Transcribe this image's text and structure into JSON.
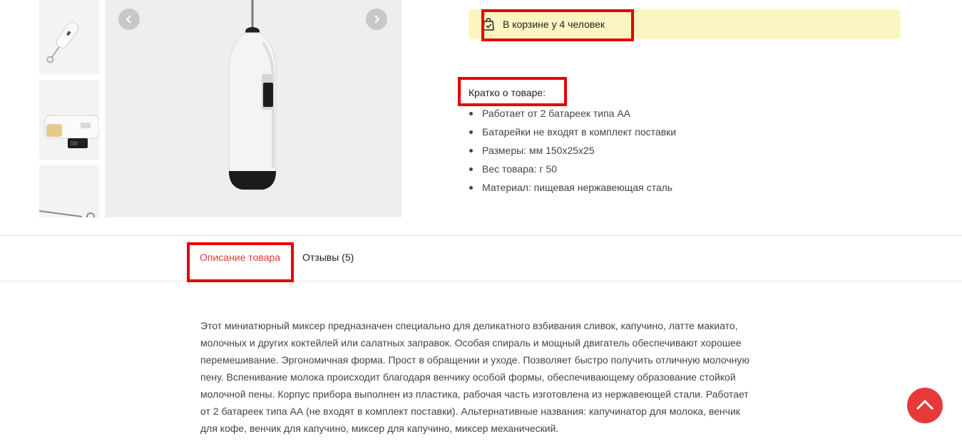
{
  "gallery": {
    "thumbnails": [
      "mixer-thumb-1",
      "mixer-thumb-2",
      "mixer-thumb-3"
    ],
    "prev_icon": "chevron-left-icon",
    "next_icon": "chevron-right-icon"
  },
  "cart_notice": {
    "icon": "shopping-bag-check-icon",
    "text": "В корзине у 4 человек"
  },
  "short_info": {
    "title": "Кратко о товаре:",
    "items": [
      "Работает от 2 батареек типа АА",
      "Батарейки не входят в комплект поставки",
      "Размеры: мм 150x25x25",
      "Вес товара: г 50",
      "Материал: пищевая нержавеющая сталь"
    ]
  },
  "tabs": [
    {
      "label": "Описание товара",
      "active": true
    },
    {
      "label": "Отзывы (5)",
      "active": false
    }
  ],
  "description": {
    "lines": [
      "Этот миниатюрный миксер предназначен специально для деликатного взбивания сливок, капучино, латте макиато,",
      "молочных и других коктейлей или салатных заправок. Особая спираль и мощный двигатель обеспечивают хорошее",
      "перемешивание. Эргономичная форма. Прост в обращении и уходе. Позволяет быстро получить отличную молочную",
      "пену. Вспенивание молока происходит благодаря венчику особой формы, обеспечивающему образование стойкой",
      "молочной пены. Корпус прибора выполнен из пластика, рабочая часть изготовлена из нержавеющей стали. Работает",
      "от 2 батареек типа АА (не входят в комплект поставки). Альтернативные названия: капучинатор для молока, венчик",
      "для кофе, венчик для капучино, миксер для капучино, миксер механический."
    ]
  },
  "colors": {
    "accent": "#e0383b",
    "highlight": "#e60000",
    "cart_bg": "#fdf5c1",
    "scroll_button": "#e5393a"
  },
  "scroll_top": {
    "icon": "chevron-up-icon"
  }
}
